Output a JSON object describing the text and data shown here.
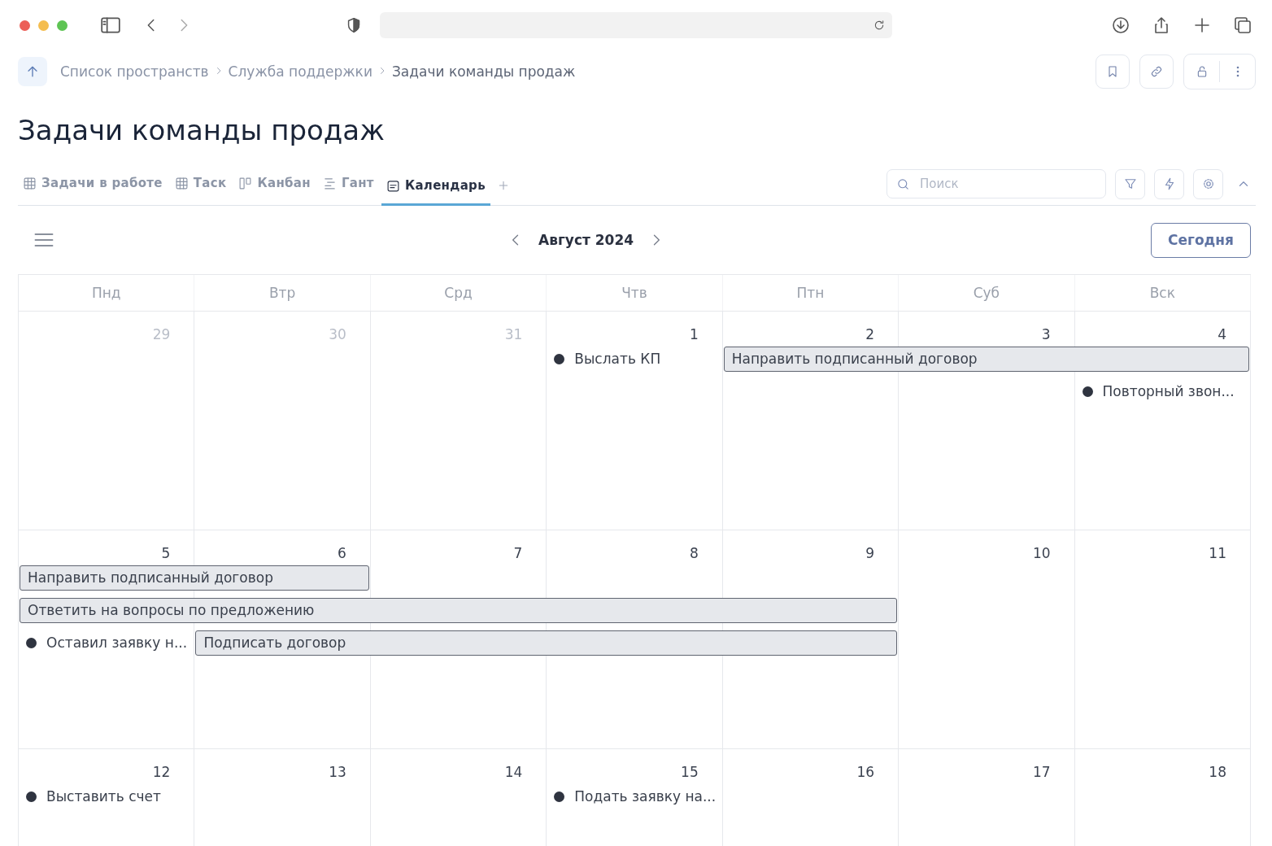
{
  "breadcrumbs": [
    "Список пространств",
    "Служба поддержки",
    "Задачи команды продаж"
  ],
  "title": "Задачи команды продаж",
  "tabs": [
    {
      "label": "Задачи в работе",
      "kind": "table",
      "selected": false
    },
    {
      "label": "Таск",
      "kind": "table",
      "selected": false
    },
    {
      "label": "Канбан",
      "kind": "kanban",
      "selected": false
    },
    {
      "label": "Гант",
      "kind": "gantt",
      "selected": false
    },
    {
      "label": "Календарь",
      "kind": "calendar",
      "selected": true
    }
  ],
  "search": {
    "placeholder": "Поиск"
  },
  "calendar": {
    "month": "Август 2024",
    "today_button": "Сегодня",
    "weekdays": [
      "Пнд",
      "Втр",
      "Срд",
      "Чтв",
      "Птн",
      "Суб",
      "Вск"
    ],
    "weeks": [
      {
        "days": [
          {
            "label": "29",
            "muted": true
          },
          {
            "label": "30",
            "muted": true
          },
          {
            "label": "31",
            "muted": true
          },
          {
            "label": "1",
            "muted": false
          },
          {
            "label": "2",
            "muted": false
          },
          {
            "label": "3",
            "muted": false
          },
          {
            "label": "4",
            "muted": false
          }
        ],
        "lanes": [
          [
            {
              "kind": "empty"
            },
            {
              "kind": "empty"
            },
            {
              "kind": "empty"
            },
            {
              "kind": "dot",
              "title": "Выслать КП"
            },
            {
              "kind": "bar",
              "title": "Направить подписанный договор"
            },
            {
              "kind": "continued"
            },
            {
              "kind": "continued"
            }
          ],
          [
            {
              "kind": "empty"
            },
            {
              "kind": "empty"
            },
            {
              "kind": "empty"
            },
            {
              "kind": "empty"
            },
            {
              "kind": "empty"
            },
            {
              "kind": "empty"
            },
            {
              "kind": "dot",
              "title": "Повторный звон..."
            }
          ]
        ]
      },
      {
        "days": [
          {
            "label": "5",
            "muted": false
          },
          {
            "label": "6",
            "muted": false
          },
          {
            "label": "7",
            "muted": false
          },
          {
            "label": "8",
            "muted": false
          },
          {
            "label": "9",
            "muted": false
          },
          {
            "label": "10",
            "muted": false
          },
          {
            "label": "11",
            "muted": false
          }
        ],
        "lanes": [
          [
            {
              "kind": "bar",
              "title": "Направить подписанный договор"
            },
            {
              "kind": "continued"
            },
            {
              "kind": "empty"
            },
            {
              "kind": "empty"
            },
            {
              "kind": "empty"
            },
            {
              "kind": "empty"
            },
            {
              "kind": "empty"
            }
          ],
          [
            {
              "kind": "bar",
              "title": "Ответить на вопросы по предложению"
            },
            {
              "kind": "continued"
            },
            {
              "kind": "continued"
            },
            {
              "kind": "continued"
            },
            {
              "kind": "continued"
            },
            {
              "kind": "empty"
            },
            {
              "kind": "empty"
            }
          ],
          [
            {
              "kind": "dot",
              "title": "Оставил заявку н..."
            },
            {
              "kind": "bar",
              "title": "Подписать договор"
            },
            {
              "kind": "continued"
            },
            {
              "kind": "continued"
            },
            {
              "kind": "continued"
            },
            {
              "kind": "empty"
            },
            {
              "kind": "empty"
            }
          ]
        ]
      },
      {
        "days": [
          {
            "label": "12",
            "muted": false
          },
          {
            "label": "13",
            "muted": false
          },
          {
            "label": "14",
            "muted": false
          },
          {
            "label": "15",
            "muted": false
          },
          {
            "label": "16",
            "muted": false
          },
          {
            "label": "17",
            "muted": false
          },
          {
            "label": "18",
            "muted": false
          }
        ],
        "lanes": [
          [
            {
              "kind": "dot",
              "title": "Выставить счет"
            },
            {
              "kind": "empty"
            },
            {
              "kind": "empty"
            },
            {
              "kind": "dot",
              "title": "Подать заявку на..."
            },
            {
              "kind": "empty"
            },
            {
              "kind": "empty"
            },
            {
              "kind": "empty"
            }
          ]
        ]
      }
    ]
  }
}
